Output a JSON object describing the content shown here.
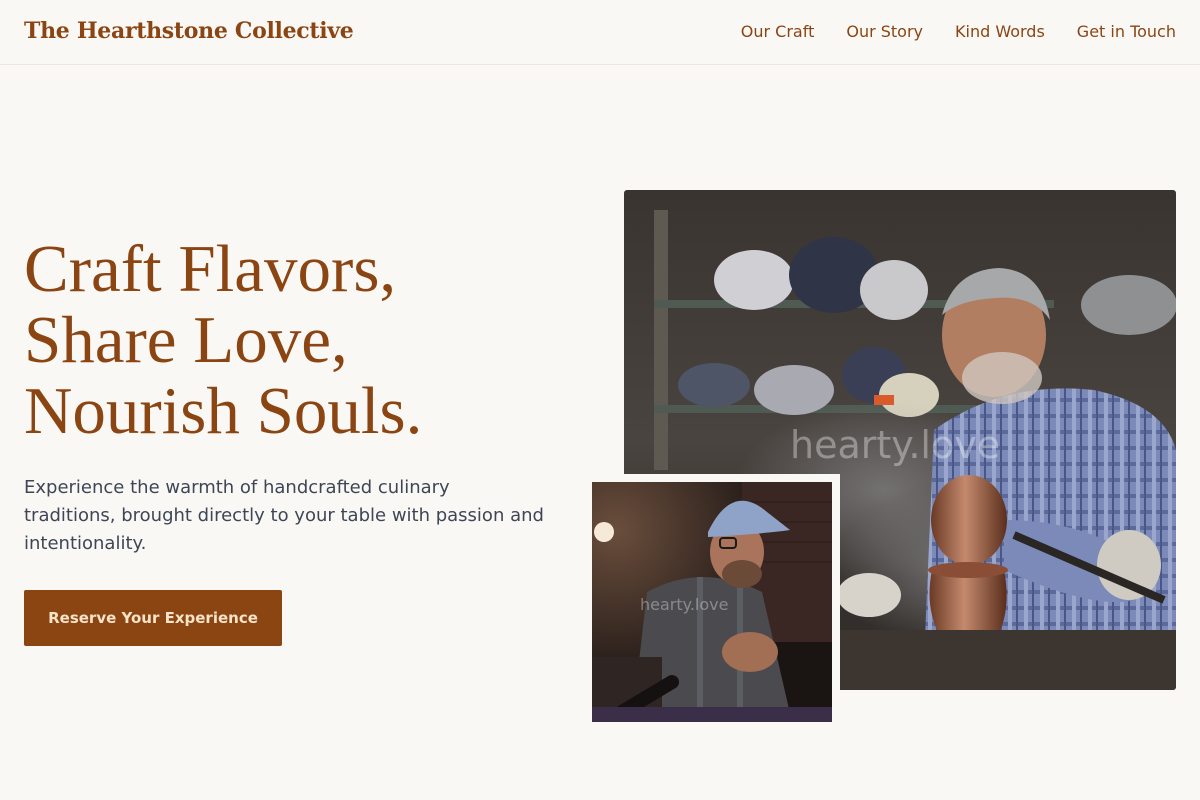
{
  "header": {
    "brand": "The Hearthstone Collective",
    "nav": [
      {
        "label": "Our Craft"
      },
      {
        "label": "Our Story"
      },
      {
        "label": "Kind Words"
      },
      {
        "label": "Get in Touch"
      }
    ]
  },
  "hero": {
    "headline": [
      "Craft Flavors,",
      "Share Love,",
      "Nourish Souls."
    ],
    "subtext": "Experience the warmth of handcrafted culinary traditions, brought directly to your table with passion and intentionality.",
    "cta_label": "Reserve Your Experience"
  },
  "images": {
    "main_watermark": "hearty.love",
    "inset_watermark": "hearty.love"
  },
  "colors": {
    "brand": "#8b4513",
    "background": "#faf8f5",
    "body_text": "#3e4656",
    "cta_text": "#f6e3c8"
  }
}
